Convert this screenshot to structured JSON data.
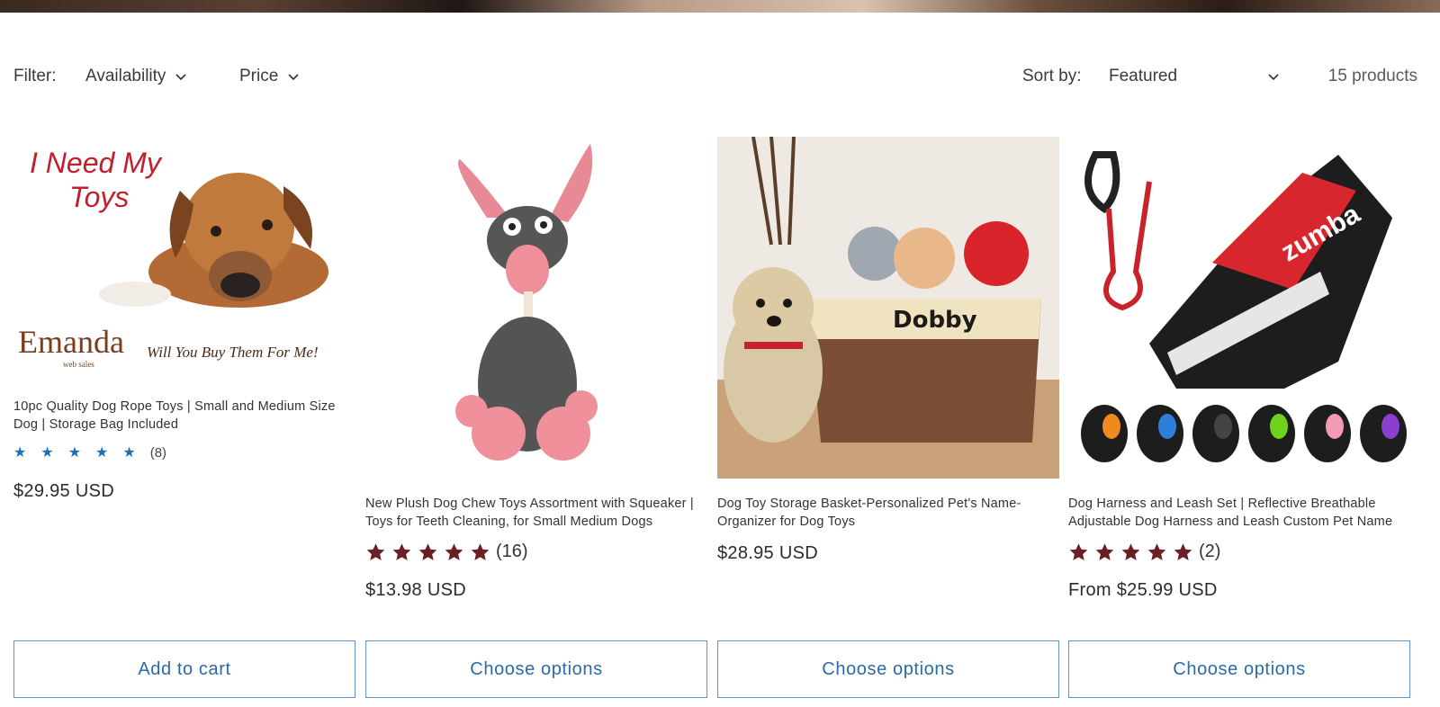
{
  "filter": {
    "label": "Filter:",
    "availability": "Availability",
    "price": "Price"
  },
  "sort": {
    "label": "Sort by:",
    "value": "Featured"
  },
  "product_count": "15 products",
  "products": [
    {
      "title": "10pc Quality Dog Rope Toys | Small and Medium Size Dog | Storage Bag Included",
      "rating_count": "(8)",
      "price": "$29.95 USD",
      "button": "Add to cart",
      "image_text": {
        "headline_1": "I Need My",
        "headline_2": "Toys",
        "brand": "Emanda",
        "brand_sub": "web sales",
        "tagline": "Will You Buy Them For Me!"
      }
    },
    {
      "title": "New Plush Dog Chew Toys Assortment with Squeaker | Toys for Teeth Cleaning, for Small Medium Dogs",
      "rating_count": "(16)",
      "price": "$13.98 USD",
      "button": "Choose options"
    },
    {
      "title": "Dog Toy Storage Basket-Personalized Pet's Name-Organizer for Dog Toys",
      "price": "$28.95 USD",
      "button": "Choose options",
      "image_text": {
        "basket_name": "Dobby"
      }
    },
    {
      "title": "Dog Harness and Leash Set | Reflective Breathable Adjustable Dog Harness and Leash Custom Pet Name",
      "rating_count": "(2)",
      "price": "From $25.99 USD",
      "button": "Choose options",
      "image_text": {
        "harness_brand": "zumba"
      }
    }
  ],
  "colors": {
    "button_border": "#5f94cc",
    "button_text": "#2c6aa8",
    "star_blue": "#1f6fb7",
    "star_dark_red": "#6b1f24"
  }
}
